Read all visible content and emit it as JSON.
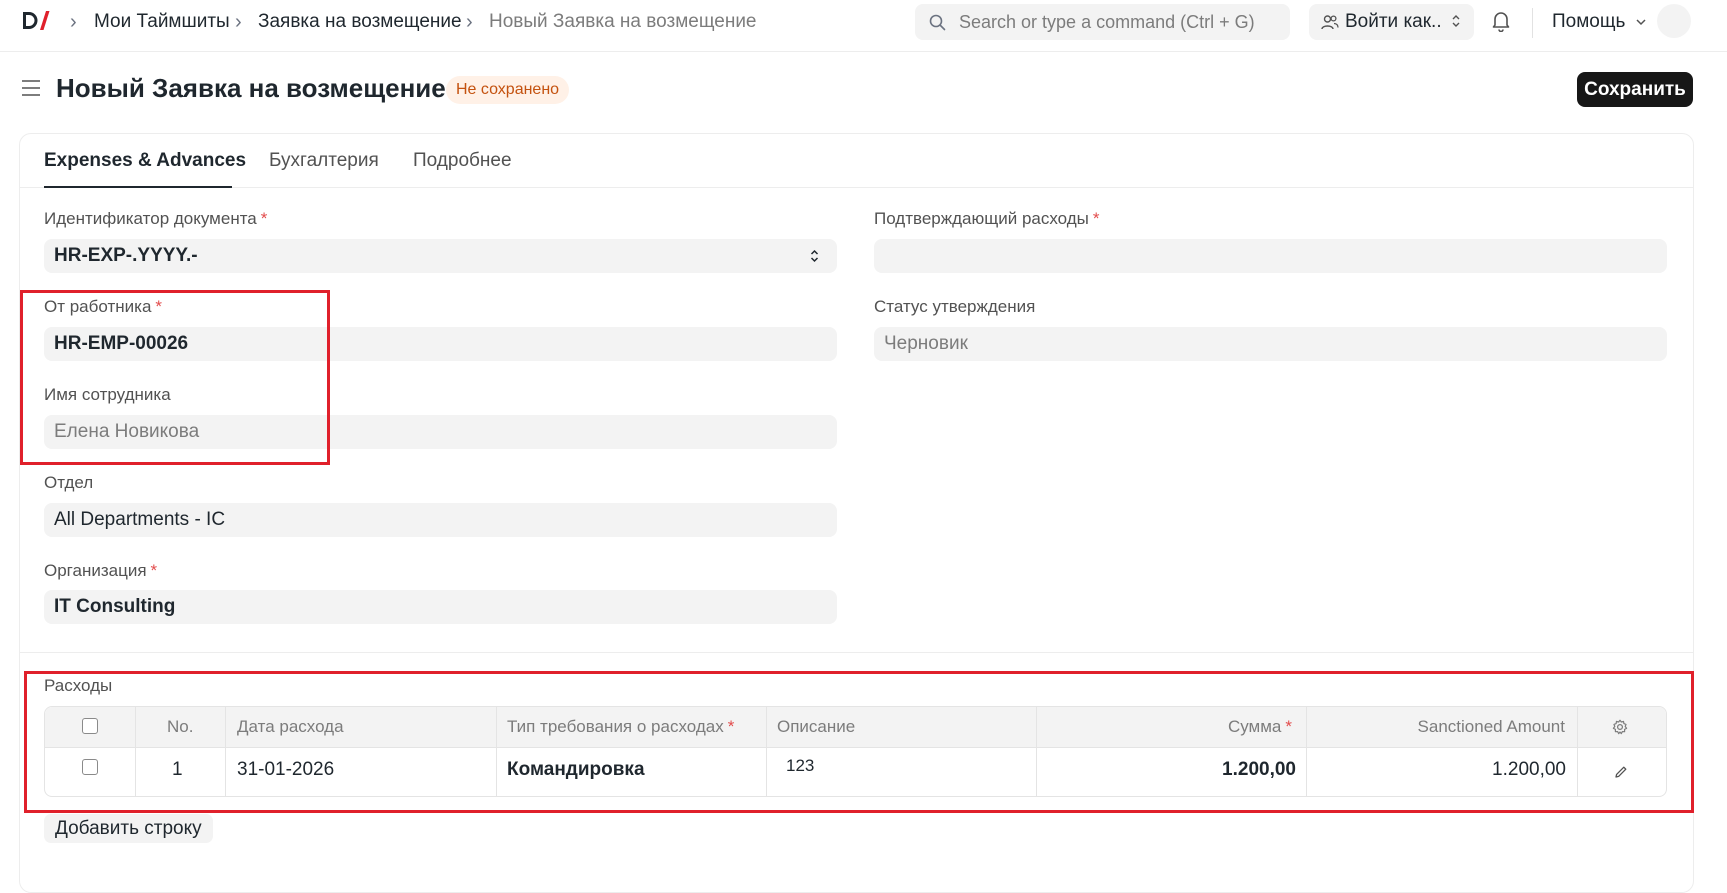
{
  "navbar": {
    "breadcrumbs": [
      "Мои Таймшиты",
      "Заявка на возмещение",
      "Новый Заявка на возмещение"
    ],
    "search_placeholder": "Search or type a command (Ctrl + G)",
    "login_as_label": "Войти как..",
    "help_label": "Помощь"
  },
  "page": {
    "title": "Новый Заявка на возмещение",
    "status": "Не сохранено",
    "save_label": "Сохранить"
  },
  "tabs": [
    "Expenses & Advances",
    "Бухгалтерия",
    "Подробнее"
  ],
  "fields": {
    "naming_series": {
      "label": "Идентификатор документа",
      "value": "HR-EXP-.YYYY.-"
    },
    "employee": {
      "label": "От работника",
      "value": "HR-EMP-00026"
    },
    "employee_name": {
      "label": "Имя сотрудника",
      "value": "Елена Новикова"
    },
    "department": {
      "label": "Отдел",
      "value": "All Departments - IC"
    },
    "company": {
      "label": "Организация",
      "value": "IT Consulting"
    },
    "expense_approver": {
      "label": "Подтверждающий расходы",
      "value": ""
    },
    "approval_status": {
      "label": "Статус утверждения",
      "value": "Черновик"
    }
  },
  "required_mark": "*",
  "expenses": {
    "label": "Расходы",
    "columns": [
      "No.",
      "Дата расхода",
      "Тип требования о расходах",
      "Описание",
      "Сумма",
      "Sanctioned Amount"
    ],
    "rows": [
      {
        "no": "1",
        "date": "31-01-2026",
        "type": "Командировка",
        "description": "123",
        "amount": "1.200,00",
        "sanctioned": "1.200,00"
      }
    ],
    "add_row_label": "Добавить строку"
  },
  "colors": {
    "accent": "#171717",
    "highlight": "#e0202b",
    "status_bg": "#fff1e7",
    "status_text": "#c4520f"
  }
}
